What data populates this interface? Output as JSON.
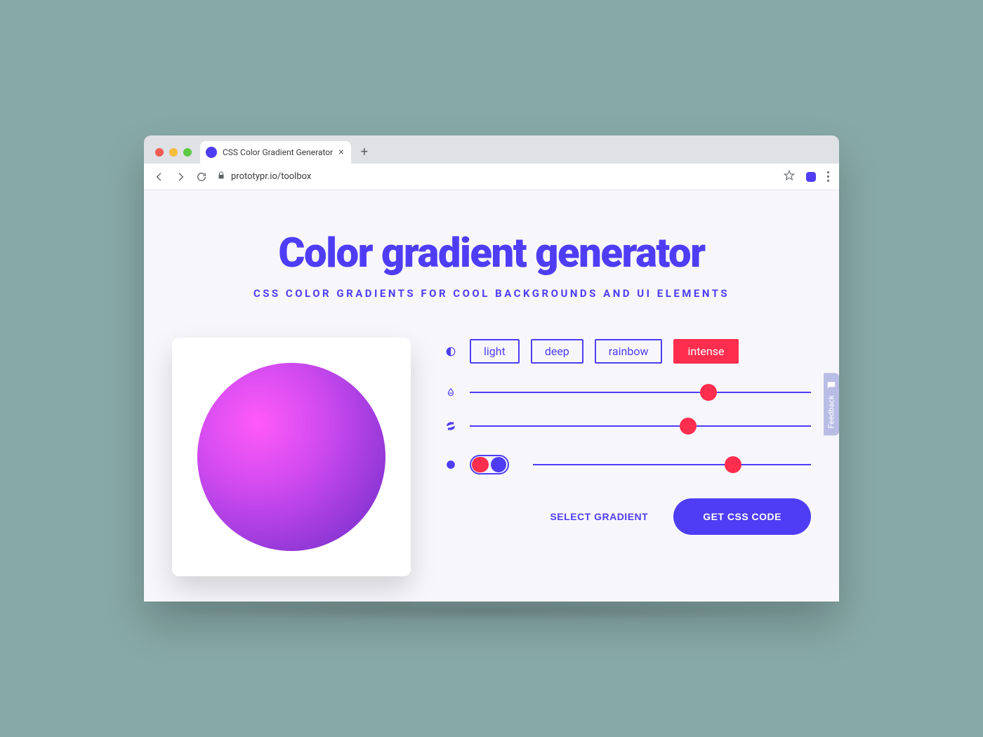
{
  "browser": {
    "tab_title": "CSS Color Gradient Generator",
    "url": "prototypr.io/toolbox"
  },
  "page": {
    "title": "Color gradient generator",
    "subtitle": "CSS COLOR GRADIENTS FOR COOL BACKGROUNDS AND UI ELEMENTS"
  },
  "presets": {
    "items": [
      "light",
      "deep",
      "rainbow",
      "intense"
    ],
    "active": "intense"
  },
  "sliders": {
    "hue_pct": 70,
    "rotate_pct": 64,
    "third_pct": 72
  },
  "toggle": {
    "on": true
  },
  "actions": {
    "select_label": "SELECT GRADIENT",
    "css_label": "GET CSS CODE"
  },
  "feedback": {
    "label": "Feedback"
  },
  "colors": {
    "accent": "#4f3df5",
    "danger": "#ff2d4e"
  }
}
